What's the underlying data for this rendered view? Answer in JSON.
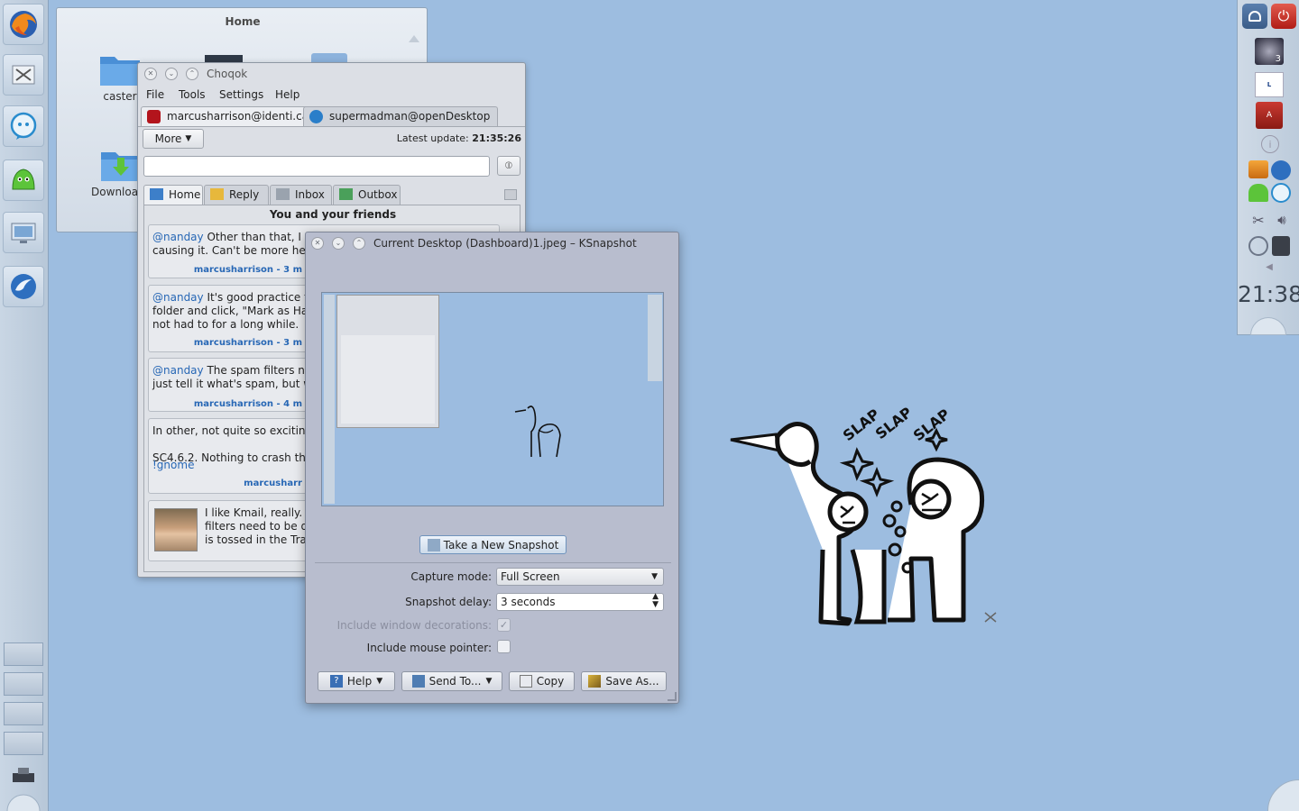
{
  "folder_view": {
    "title": "Home",
    "items": [
      "caster",
      "Downloads"
    ]
  },
  "choqok": {
    "title": "Choqok",
    "menu": [
      "File",
      "Tools",
      "Settings",
      "Help"
    ],
    "accounts": [
      "marcusharrison@identi.ca",
      "supermadman@openDesktop"
    ],
    "more_label": "More",
    "latest_update_label": "Latest update:",
    "latest_update_time": "21:35:26",
    "post_input_placeholder": "",
    "tabs": [
      "Home",
      "Reply",
      "Inbox",
      "Outbox"
    ],
    "timeline_heading": "You and your friends",
    "posts": [
      {
        "mention": "@nanday",
        "text": " Other than that, I don\ncausing it. Can't be more help,",
        "meta": "marcusharrison - 3 m"
      },
      {
        "mention": "@nanday",
        "text": " It's good practice to s\nfolder and click, \"Mark as Ham\"\nnot had to for a long while.",
        "meta": "marcusharrison - 3 m"
      },
      {
        "mention": "@nanday",
        "text": " The spam filters need\njust tell it what's spam, but wha",
        "meta": "marcusharrison - 4 m"
      },
      {
        "mention": "",
        "text": "In other, not quite so exciting r\n\nSC4.6.2. Nothing to crash the s",
        "tag": "!gnome",
        "meta": "marcusharr"
      },
      {
        "mention": "",
        "text": "I like Kmail, really. Bu\nfilters need to be de\nis tossed in the Trash",
        "meta": ""
      }
    ]
  },
  "ksnapshot": {
    "title": "Current Desktop (Dashboard)1.jpeg – KSnapshot",
    "take_snapshot": "Take a New Snapshot",
    "capture_mode_label": "Capture mode:",
    "capture_mode_value": "Full Screen",
    "snapshot_delay_label": "Snapshot delay:",
    "snapshot_delay_value": "3 seconds",
    "include_decorations_label": "Include window decorations:",
    "include_decorations_checked": true,
    "include_pointer_label": "Include mouse pointer:",
    "include_pointer_checked": false,
    "buttons": [
      "Help",
      "Send To...",
      "Copy",
      "Save As..."
    ]
  },
  "right_panel": {
    "clock": "21:38",
    "badge": "3"
  },
  "wallpaper": {
    "sound_effects": [
      "SLAP",
      "SLAP",
      "SLAP"
    ]
  },
  "colors": {
    "desktop": "#9dbde0",
    "link": "#2767b5",
    "ksnapshot_bg": "#b8bdce"
  }
}
